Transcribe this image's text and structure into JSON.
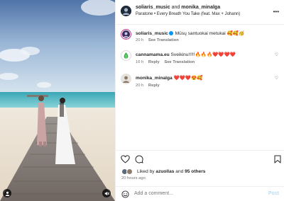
{
  "header": {
    "user1": "soliaris_music",
    "and": "and",
    "user2": "monika_minalga",
    "song": "Paratone • Every Breath You Take (feat. Max + Johann)"
  },
  "comments": [
    {
      "user": "soliaris_music",
      "text": "Mūsų santuokai metukai 🥰🥰🥳",
      "time": "20 h",
      "action": "See Translation"
    },
    {
      "user": "cannamama.eu",
      "text": "Sveikinu!!!!!🔥🔥🔥❤️❤️❤️❤️",
      "time": "16 h",
      "reply": "Reply",
      "action": "See Translation"
    },
    {
      "user": "monika_minalga",
      "text": "❤️❤️❤️😍🥰",
      "time": "20 h",
      "reply": "Reply"
    }
  ],
  "likes": {
    "prefix": "Liked by",
    "user": "azuollas",
    "and": "and",
    "count": "95 others"
  },
  "time_ago": "20 hours ago",
  "composer": {
    "placeholder": "Add a comment...",
    "post": "Post"
  },
  "colors": {
    "accent": "#0095f6",
    "muted": "#737373",
    "border": "#efefef"
  }
}
